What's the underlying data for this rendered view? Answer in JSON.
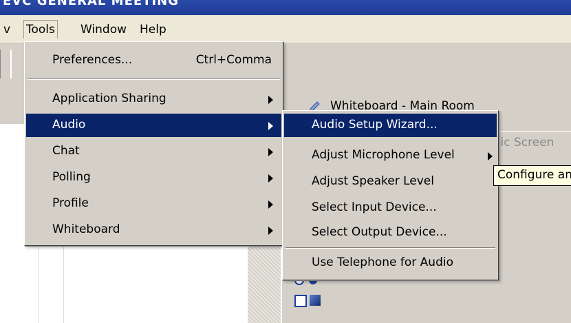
{
  "window": {
    "title": "EVC GENERAL MEETING"
  },
  "menubar": {
    "partial_item": "v",
    "items": [
      "Tools",
      "Window",
      "Help"
    ]
  },
  "tools_menu": {
    "items": [
      {
        "label": "Preferences...",
        "shortcut": "Ctrl+Comma",
        "submenu": false
      },
      {
        "label": "Application Sharing",
        "submenu": true
      },
      {
        "label": "Audio",
        "submenu": true,
        "highlighted": true
      },
      {
        "label": "Chat",
        "submenu": true
      },
      {
        "label": "Polling",
        "submenu": true
      },
      {
        "label": "Profile",
        "submenu": true
      },
      {
        "label": "Whiteboard",
        "submenu": true
      }
    ]
  },
  "audio_submenu": {
    "items": [
      {
        "label": "Audio Setup Wizard...",
        "highlighted": true
      },
      {
        "label": "Adjust Microphone Level",
        "submenu": true
      },
      {
        "label": "Adjust Speaker Level",
        "submenu": true
      },
      {
        "label": "Select Input Device..."
      },
      {
        "label": "Select Output Device..."
      },
      {
        "label": "Use Telephone for Audio"
      }
    ]
  },
  "tooltip": {
    "text": "Configure and"
  },
  "whiteboard": {
    "title": "Whiteboard - Main Room",
    "tab": "blic Screen"
  },
  "colors": {
    "highlight": "#0a246a",
    "menu_bg": "#d4d0c8",
    "titlebar": "#2a4aa8",
    "tooltip_bg": "#ffffe1"
  }
}
